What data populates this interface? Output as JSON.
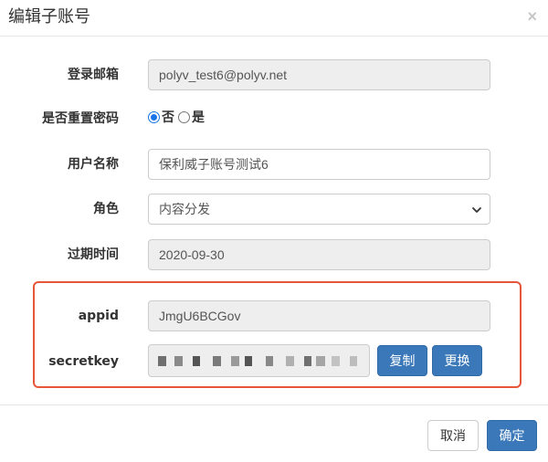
{
  "modal": {
    "title": "编辑子账号",
    "close_symbol": "×"
  },
  "form": {
    "email": {
      "label": "登录邮箱",
      "value": "polyv_test6@polyv.net"
    },
    "reset_password": {
      "label": "是否重置密码",
      "options": [
        {
          "label": "否",
          "checked": true
        },
        {
          "label": "是",
          "checked": false
        }
      ]
    },
    "username": {
      "label": "用户名称",
      "value": "保利威子账号测试6"
    },
    "role": {
      "label": "角色",
      "selected": "内容分发"
    },
    "expiry": {
      "label": "过期时间",
      "value": "2020-09-30"
    },
    "appid": {
      "label": "appid",
      "value": "JmgU6BCGov"
    },
    "secretkey": {
      "label": "secretkey",
      "copy_label": "复制",
      "change_label": "更换"
    }
  },
  "footer": {
    "cancel_label": "取消",
    "confirm_label": "确定"
  },
  "colors": {
    "primary": "#3a78b9",
    "highlight_border": "#e8563a",
    "readonly_bg": "#eeeeee"
  }
}
